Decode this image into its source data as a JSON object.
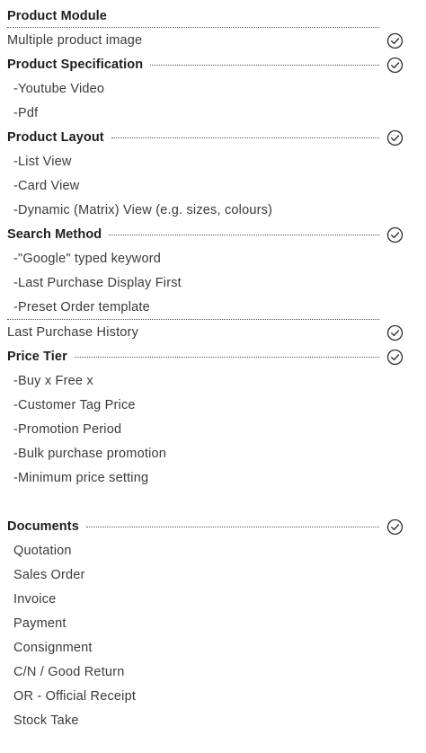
{
  "product_module": {
    "title": "Product Module",
    "multiple_image": "Multiple product image"
  },
  "product_specification": {
    "title": "Product Specification",
    "items": [
      "-Youtube Video",
      "-Pdf"
    ]
  },
  "product_layout": {
    "title": "Product Layout",
    "items": [
      "-List View",
      "-Card View",
      "-Dynamic (Matrix) View (e.g. sizes, colours)"
    ]
  },
  "search_method": {
    "title": "Search Method",
    "items": [
      "-\"Google\" typed keyword",
      "-Last Purchase Display First",
      "-Preset Order template"
    ]
  },
  "last_purchase_history": "Last Purchase History",
  "price_tier": {
    "title": "Price Tier",
    "items": [
      "-Buy x Free x",
      "-Customer Tag Price",
      "-Promotion Period",
      "-Bulk purchase promotion",
      "-Minimum price setting"
    ]
  },
  "documents": {
    "title": "Documents",
    "items": [
      "Quotation",
      "Sales Order",
      "Invoice",
      "Payment",
      "Consignment",
      "C/N / Good Return",
      "OR - Official Receipt",
      "Stock Take"
    ]
  },
  "icon": "check-circle-icon",
  "colors": {
    "text": "#3a3a3a",
    "heading": "#1e1e1e",
    "icon": "#333333"
  }
}
